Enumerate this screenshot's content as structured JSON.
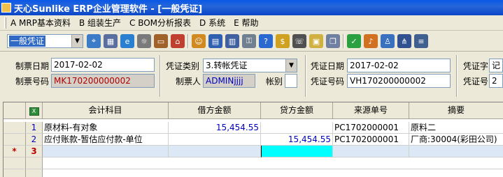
{
  "window": {
    "title": "天心Sunlike ERP企业管理软件 - [一般凭证]"
  },
  "menu": [
    {
      "label": "A MRP基本资料"
    },
    {
      "label": "B 组装生产"
    },
    {
      "label": "C BOM分析报表"
    },
    {
      "label": "D 系统"
    },
    {
      "label": "E 帮助"
    }
  ],
  "toolbar": {
    "doc_type_value": "一般凭证",
    "icons": [
      {
        "name": "find-icon",
        "color": "#3b7bc8",
        "glyph": "⌖"
      },
      {
        "name": "grid-icon",
        "color": "#5a6fa0",
        "glyph": "▦"
      },
      {
        "name": "ie-icon",
        "color": "#2a80d0",
        "glyph": "e"
      },
      {
        "name": "settings-icon",
        "color": "#7a7a7a",
        "glyph": "☼"
      },
      {
        "name": "briefcase-icon",
        "color": "#a0622a",
        "glyph": "▭"
      },
      {
        "name": "home-icon",
        "color": "#c04030",
        "glyph": "⌂"
      },
      {
        "name": "people-icon",
        "color": "#d08a20",
        "glyph": "☺"
      },
      {
        "name": "doc-icon",
        "color": "#3060b0",
        "glyph": "▤"
      },
      {
        "name": "book-icon",
        "color": "#4060a0",
        "glyph": "▥"
      },
      {
        "name": "key-icon",
        "color": "#708090",
        "glyph": "⚿"
      },
      {
        "name": "help-icon",
        "color": "#2a6ad0",
        "glyph": "?"
      },
      {
        "name": "money-icon",
        "color": "#d0a020",
        "glyph": "$"
      },
      {
        "name": "phone-icon",
        "color": "#505050",
        "glyph": "☏"
      },
      {
        "name": "folder-icon",
        "color": "#d0b040",
        "glyph": "▣"
      },
      {
        "name": "copy-icon",
        "color": "#7080a0",
        "glyph": "❐"
      },
      {
        "name": "check-icon",
        "color": "#2aa040",
        "glyph": "✓"
      },
      {
        "name": "bell-icon",
        "color": "#d07020",
        "glyph": "♪"
      },
      {
        "name": "user-icon",
        "color": "#3a70c0",
        "glyph": "♙"
      },
      {
        "name": "tree-icon",
        "color": "#305090",
        "glyph": "⋔"
      },
      {
        "name": "list-icon",
        "color": "#406090",
        "glyph": "≡"
      }
    ]
  },
  "form": {
    "doc_date_label": "制票日期",
    "doc_date": "2017-02-02",
    "doc_no_label": "制票号码",
    "doc_no": "MK170200000002",
    "voucher_type_label": "凭证类别",
    "voucher_type": "3.转帐凭证",
    "maker_label": "制票人",
    "maker": "ADMINjjjj",
    "account_label": "帐别",
    "account": "",
    "voucher_date_label": "凭证日期",
    "voucher_date": "2017-02-02",
    "voucher_no_label": "凭证号码",
    "voucher_no": "VH170200000002",
    "voucher_word_label": "凭证字",
    "voucher_word": "记",
    "voucher_num_label": "凭证号",
    "voucher_num": "2"
  },
  "grid": {
    "columns": [
      "会计科目",
      "借方金额",
      "贷方金额",
      "来源单号",
      "摘要"
    ],
    "rows": [
      {
        "no": "1",
        "subject": "原材料-有对象",
        "debit": "15,454.55",
        "credit": "",
        "source": "PC1702000001",
        "summary": "原料二"
      },
      {
        "no": "2",
        "subject": "应付账款-暂估应付款-单位",
        "debit": "",
        "credit": "15,454.55",
        "source": "PC1702000001",
        "summary": "厂商:30004(彩田公司)"
      },
      {
        "no": "3",
        "subject": "",
        "debit": "",
        "credit": "",
        "source": "",
        "summary": ""
      }
    ],
    "current_row_marker": "*",
    "highlight_color": "#00ffff"
  }
}
